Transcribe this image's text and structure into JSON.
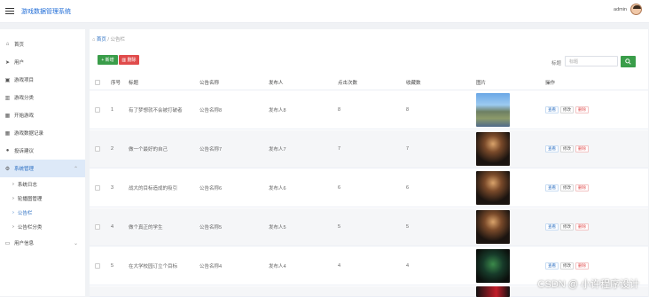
{
  "app": {
    "title": "游戏数据管理系统",
    "username": "admin"
  },
  "sidebar": {
    "items": [
      {
        "label": "首页",
        "icon": "home-icon"
      },
      {
        "label": "用户",
        "icon": "send-icon"
      },
      {
        "label": "游戏项目",
        "icon": "clipboard-icon"
      },
      {
        "label": "游戏分类",
        "icon": "chart-icon"
      },
      {
        "label": "开始游戏",
        "icon": "grid-icon"
      },
      {
        "label": "游戏数据记录",
        "icon": "grid-icon"
      },
      {
        "label": "投诉建议",
        "icon": "pin-icon"
      },
      {
        "label": "系统管理",
        "icon": "gear-icon"
      }
    ],
    "sub_items": [
      {
        "label": "系统日志"
      },
      {
        "label": "轮播图管理"
      },
      {
        "label": "公告栏"
      },
      {
        "label": "公告栏分类"
      }
    ],
    "user_info": "用户信息"
  },
  "breadcrumb": {
    "home": "首页",
    "separator": "/",
    "current": "公告栏"
  },
  "toolbar": {
    "add_label": "+ 新增",
    "delete_label": "删除",
    "search_label": "标题",
    "search_placeholder": "标题"
  },
  "table": {
    "headers": {
      "index": "序号",
      "title": "标题",
      "category": "公告名称",
      "publisher": "发布人",
      "clicks": "点击次数",
      "favorites": "收藏数",
      "image": "图片",
      "actions": "操作"
    },
    "actions": {
      "view": "查看",
      "edit": "修改",
      "delete": "删除"
    },
    "rows": [
      {
        "index": "1",
        "title": "有了梦想就不会被打破者",
        "category": "公告名称8",
        "publisher": "发布人8",
        "clicks": "8",
        "favorites": "8",
        "image": "rocky-island-game-cover"
      },
      {
        "index": "2",
        "title": "做一个最好的自己",
        "category": "公告名称7",
        "publisher": "发布人7",
        "clicks": "7",
        "favorites": "7",
        "image": "action-hero-game-cover"
      },
      {
        "index": "3",
        "title": "战大的目标造成的吸引",
        "category": "公告名称6",
        "publisher": "发布人6",
        "clicks": "6",
        "favorites": "6",
        "image": "action-hero-game-cover"
      },
      {
        "index": "4",
        "title": "做个真正的学生",
        "category": "公告名称5",
        "publisher": "发布人5",
        "clicks": "5",
        "favorites": "5",
        "image": "action-hero-game-cover"
      },
      {
        "index": "5",
        "title": "在大学校园订立个目标",
        "category": "公告名称4",
        "publisher": "发布人4",
        "clicks": "4",
        "favorites": "4",
        "image": "zelda-game-cover"
      }
    ]
  },
  "watermark": "CSDN @ 小许程序设计"
}
